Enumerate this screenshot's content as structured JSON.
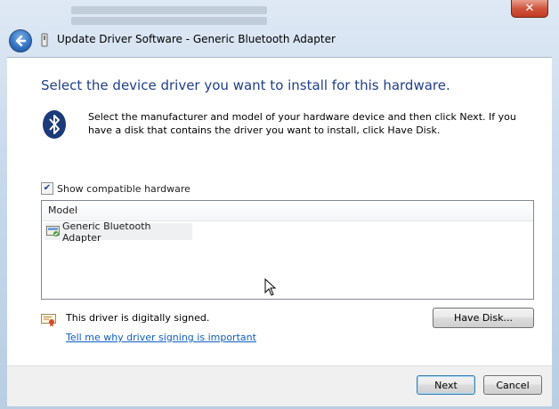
{
  "window": {
    "title": "Update Driver Software - Generic Bluetooth Adapter",
    "close_label": "✕"
  },
  "main": {
    "heading": "Select the device driver you want to install for this hardware.",
    "description": "Select the manufacturer and model of your hardware device and then click Next. If you have a disk that contains the driver you want to install, click Have Disk.",
    "show_compatible": {
      "label": "Show compatible hardware",
      "checked": true
    },
    "model_list": {
      "column_header": "Model",
      "items": [
        {
          "label": "Generic Bluetooth Adapter",
          "selected": true
        }
      ]
    },
    "signed_text": "This driver is digitally signed.",
    "signing_link": "Tell me why driver signing is important",
    "have_disk_label": "Have Disk..."
  },
  "footer": {
    "next_label": "Next",
    "cancel_label": "Cancel"
  },
  "icons": {
    "back": "back-arrow-icon",
    "title": "device-icon",
    "bluetooth": "bluetooth-icon",
    "driver": "driver-icon",
    "certificate": "certificate-icon",
    "cursor": "mouse-cursor-icon"
  },
  "colors": {
    "heading": "#1f3f8a",
    "link": "#0f5ec0",
    "close_button": "#c13b22",
    "bluetooth_badge": "#1b3a7a"
  }
}
